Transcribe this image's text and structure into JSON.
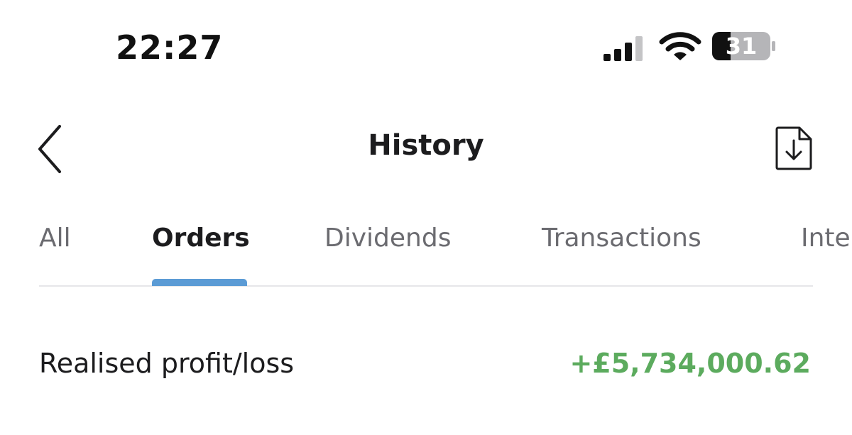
{
  "status_bar": {
    "time": "22:27",
    "battery_level": "31",
    "signal_icon": "cellular-signal-icon",
    "wifi_icon": "wifi-icon",
    "battery_icon": "battery-icon"
  },
  "header": {
    "title": "History",
    "back_icon": "chevron-left-icon",
    "download_icon": "download-document-icon"
  },
  "tabs": [
    {
      "label": "All",
      "active": false
    },
    {
      "label": "Orders",
      "active": true
    },
    {
      "label": "Dividends",
      "active": false
    },
    {
      "label": "Transactions",
      "active": false
    },
    {
      "label": "Inte",
      "active": false
    }
  ],
  "summary": {
    "label": "Realised profit/loss",
    "value": "+£5,734,000.62"
  },
  "colors": {
    "accent": "#5b9bd5",
    "positive": "#5cab5e",
    "text_primary": "#1c1c1e",
    "text_secondary": "#6b6b70"
  }
}
